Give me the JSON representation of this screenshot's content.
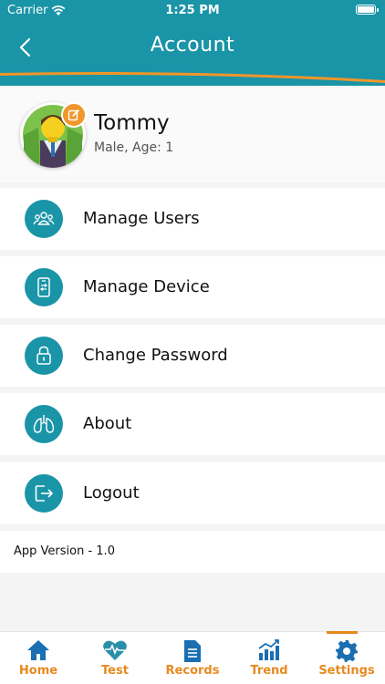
{
  "status_bar": {
    "carrier": "Carrier",
    "time": "1:25 PM"
  },
  "header": {
    "title": "Account",
    "back_icon": "chevron-left-icon",
    "color": "#1a94a7",
    "accent": "#f0962a"
  },
  "profile": {
    "name": "Tommy",
    "meta": "Male, Age: 1",
    "edit_icon": "edit-icon"
  },
  "menu": [
    {
      "label": "Manage Users",
      "icon": "users-icon"
    },
    {
      "label": "Manage Device",
      "icon": "device-icon"
    },
    {
      "label": "Change Password",
      "icon": "lock-icon"
    },
    {
      "label": "About",
      "icon": "lungs-icon"
    },
    {
      "label": "Logout",
      "icon": "logout-icon"
    }
  ],
  "app_version": "App Version - 1.0",
  "tabs": [
    {
      "label": "Home",
      "icon": "home-icon"
    },
    {
      "label": "Test",
      "icon": "heart-pulse-icon"
    },
    {
      "label": "Records",
      "icon": "document-icon"
    },
    {
      "label": "Trend",
      "icon": "chart-icon"
    },
    {
      "label": "Settings",
      "icon": "gear-icon",
      "active": true
    }
  ],
  "tab_color": "#e8891e"
}
